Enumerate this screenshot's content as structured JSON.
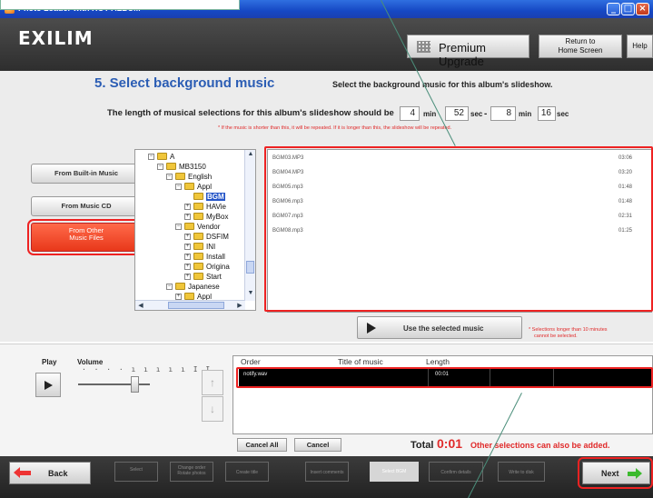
{
  "window": {
    "title": "Photo Loader with HOT ALBUM"
  },
  "header": {
    "logo": "EXILIM",
    "premium_upgrade": "Premium Upgrade",
    "return_home_line1": "Return to",
    "return_home_line2": "Home Screen",
    "help": "Help"
  },
  "step": {
    "title": "5. Select background music",
    "instruction": "Select the background music for this album's slideshow."
  },
  "length": {
    "label": "The length of musical selections for this album's slideshow should be",
    "from_min": "4",
    "from_sec": "52",
    "to_min": "8",
    "to_sec": "16",
    "min_unit": "min",
    "sec_unit": "sec",
    "dash": "-",
    "notice": "* If the music is shorter than this, it will be repeated. If it is longer than this, the slideshow will be repeated."
  },
  "sources": {
    "builtin": "From Built-in Music",
    "cd": "From Music CD",
    "other_line1": "From Other",
    "other_line2": "Music Files"
  },
  "tree": {
    "items": [
      "A",
      "MB3150",
      "English",
      "Appl",
      "BGM",
      "HAVie",
      "MyBox",
      "Vendor",
      "DSFIM",
      "INI",
      "Install",
      "Origina",
      "Start",
      "Japanese",
      "Appl"
    ]
  },
  "files": [
    {
      "name": "BGM03.MP3",
      "duration": "03:06"
    },
    {
      "name": "BGM04.MP3",
      "duration": "03:20"
    },
    {
      "name": "BGM05.mp3",
      "duration": "01:48"
    },
    {
      "name": "BGM06.mp3",
      "duration": "01:48"
    },
    {
      "name": "BGM07.mp3",
      "duration": "02:31"
    },
    {
      "name": "BGM08.mp3",
      "duration": "01:25"
    }
  ],
  "use_selected": "Use the selected music",
  "warning_line1": "* Selections longer than 10 minutes",
  "warning_line2": "cannot be selected.",
  "player": {
    "play_label": "Play",
    "volume_label": "Volume",
    "volume_ticks": "· · · · ı ı ı ı ı I I"
  },
  "table": {
    "headers": {
      "order": "Order",
      "title": "Title of music",
      "length": "Length"
    },
    "rows": [
      {
        "title": "notify.wav",
        "length": "00:01"
      }
    ]
  },
  "buttons": {
    "cancel_all": "Cancel All",
    "cancel": "Cancel"
  },
  "total": {
    "label": "Total",
    "value": "0:01",
    "note": "Other selections can also be added."
  },
  "footer": {
    "back": "Back",
    "next": "Next",
    "steps": [
      {
        "l1": "Select",
        "l2": "ephotos"
      },
      {
        "l1": "Change order",
        "l2": "Rotate photos"
      },
      {
        "l1": "Create title",
        "l2": ""
      },
      {
        "l1": "Insert comments",
        "l2": ""
      },
      {
        "l1": "Select BGM",
        "l2": ""
      },
      {
        "l1": "Confirm details",
        "l2": ""
      },
      {
        "l1": "Write to disk",
        "l2": ""
      }
    ]
  },
  "colors": {
    "accent_blue": "#2b5db4",
    "alert_red": "#e02a2a",
    "active_button": "#e8381a",
    "next_arrow": "#3cba2e"
  }
}
